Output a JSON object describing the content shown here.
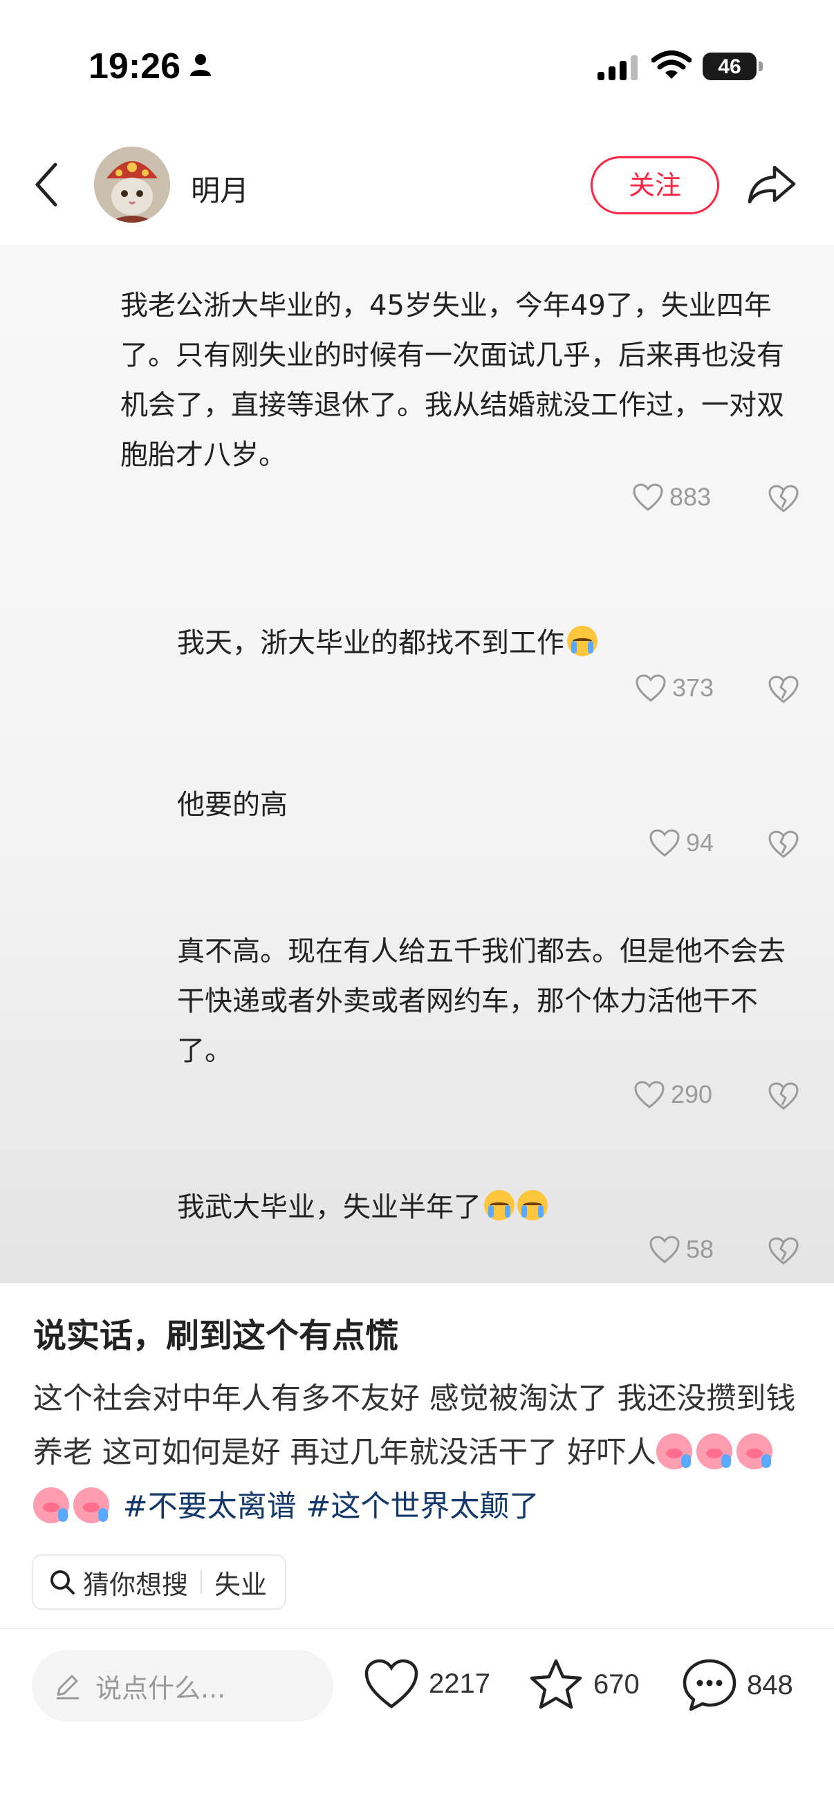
{
  "status_bar": {
    "time": "19:26",
    "battery": "46"
  },
  "header": {
    "author": "明月",
    "follow_label": "关注"
  },
  "comments": [
    {
      "text": "我老公浙大毕业的，45岁失业，今年49了，失业四年了。只有刚失业的时候有一次面试几乎，后来再也没有机会了，直接等退休了。我从结婚就没工作过，一对双胞胎才八岁。",
      "likes": "883"
    },
    {
      "text": "我天，浙大毕业的都找不到工作",
      "likes": "373"
    },
    {
      "text": "他要的高",
      "likes": "94"
    },
    {
      "text": "真不高。现在有人给五千我们都去。但是他不会去干快递或者外卖或者网约车，那个体力活他干不了。",
      "likes": "290"
    },
    {
      "text": "我武大毕业，失业半年了",
      "likes": "58"
    }
  ],
  "post": {
    "title": "说实话，刷到这个有点慌",
    "body": "这个社会对中年人有多不友好   感觉被淘汰了 我还没攒到钱养老 这可如何是好 再过几年就没活干了 好吓人",
    "tags": [
      "#不要太离谱",
      "#这个世界太颠了"
    ]
  },
  "search_chip": {
    "label": "猜你想搜",
    "keyword": "失业"
  },
  "bottom_bar": {
    "comment_placeholder": "说点什么...",
    "likes": "2217",
    "stars": "670",
    "comments": "848"
  }
}
